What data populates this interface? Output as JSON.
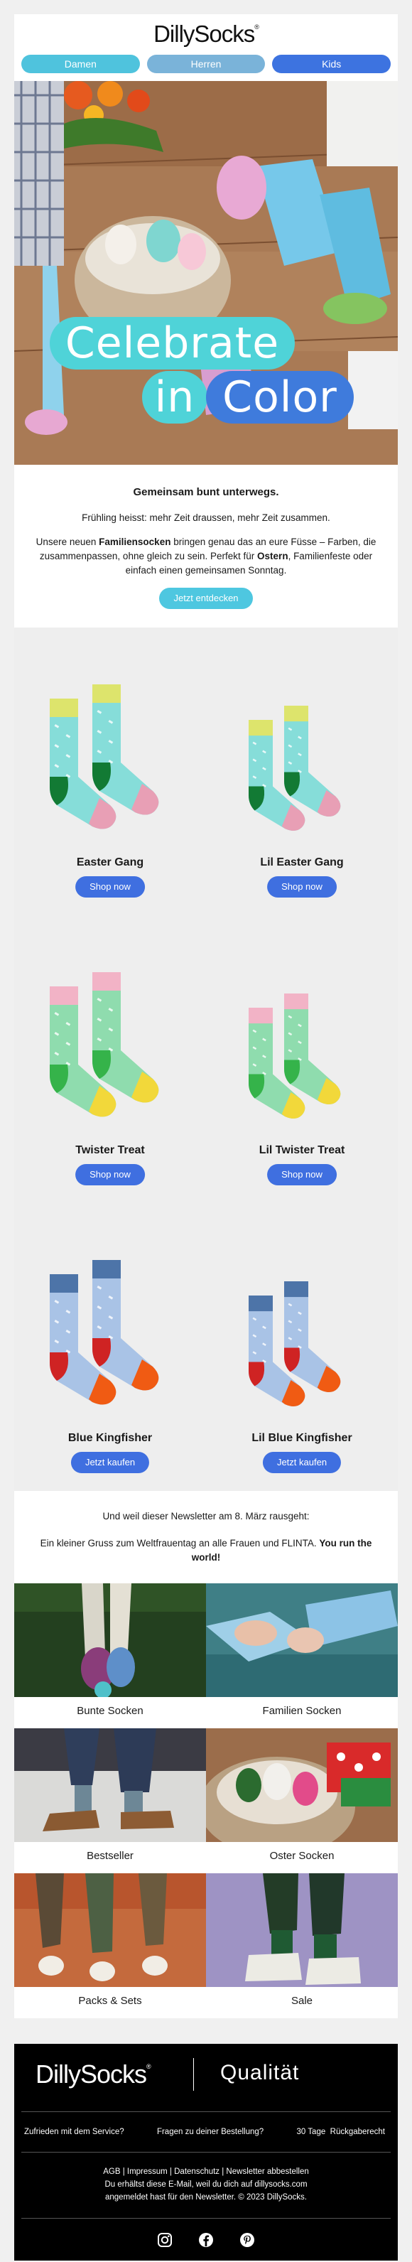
{
  "brand": {
    "name": "DillySocks",
    "mark": "®"
  },
  "nav": [
    {
      "label": "Damen",
      "color": "#4fc3dd"
    },
    {
      "label": "Herren",
      "color": "#7ab3d9"
    },
    {
      "label": "Kids",
      "color": "#3d73e0"
    }
  ],
  "hero": {
    "line1": "Celebrate",
    "line2a": "in",
    "line2b": "Color",
    "colors": {
      "cyan": "#4fd3d8",
      "blue": "#3f7bdc"
    }
  },
  "intro": {
    "heading": "Gemeinsam bunt unterwegs.",
    "line1": "Frühling heisst: mehr Zeit draussen, mehr Zeit zusammen.",
    "para_a": "Unsere neuen ",
    "para_b": "Familiensocken",
    "para_c": " bringen genau das an eure Füsse – Farben, die zusammenpassen, ohne gleich zu sein. Perfekt für ",
    "para_d": "Ostern",
    "para_e": ", Familienfeste oder einfach einen gemeinsamen Sonntag.",
    "button": "Jetzt entdecken"
  },
  "products": [
    {
      "name": "Easter Gang",
      "button": "Shop now",
      "colors": {
        "body": "#86ddd9",
        "cuff": "#dde46c",
        "heel": "#127a34",
        "toe": "#e89fb5"
      }
    },
    {
      "name": "Lil Easter Gang",
      "button": "Shop now",
      "colors": {
        "body": "#86ddd9",
        "cuff": "#dde46c",
        "heel": "#127a34",
        "toe": "#e89fb5"
      }
    },
    {
      "name": "Twister Treat",
      "button": "Shop now",
      "colors": {
        "body": "#8fdcae",
        "cuff": "#f2b3c6",
        "heel": "#35b34a",
        "toe": "#f2d83a"
      }
    },
    {
      "name": "Lil Twister Treat",
      "button": "Shop now",
      "colors": {
        "body": "#8fdcae",
        "cuff": "#f2b3c6",
        "heel": "#35b34a",
        "toe": "#f2d83a"
      }
    },
    {
      "name": "Blue Kingfisher",
      "button": "Jetzt kaufen",
      "colors": {
        "body": "#a9c3e6",
        "cuff": "#4d74a8",
        "heel": "#cf2323",
        "toe": "#f05b13"
      }
    },
    {
      "name": "Lil Blue Kingfisher",
      "button": "Jetzt kaufen",
      "colors": {
        "body": "#a9c3e6",
        "cuff": "#4d74a8",
        "heel": "#cf2323",
        "toe": "#f05b13"
      }
    }
  ],
  "message": {
    "line1": "Und weil dieser Newsletter am 8. März rausgeht:",
    "line2a": "Ein kleiner Gruss zum Weltfrauentag an alle Frauen und FLINTA. ",
    "line2b": "You run the world!"
  },
  "categories": [
    {
      "label": "Bunte Socken"
    },
    {
      "label": "Familien Socken"
    },
    {
      "label": "Bestseller"
    },
    {
      "label": "Oster Socken"
    },
    {
      "label": "Packs & Sets"
    },
    {
      "label": "Sale"
    }
  ],
  "footer": {
    "tagline": "Qualität",
    "links": [
      "Zufrieden mit dem Service?",
      "Fragen zu deiner Bestellung?",
      "30 Tage  Rückgaberecht"
    ],
    "legal_links": "AGB | Impressum | Datenschutz | Newsletter abbestellen",
    "legal_line2": "Du erhältst diese E-Mail, weil du dich auf dillysocks.com",
    "legal_line3": "angemeldet hast für den Newsletter. © 2023 DillySocks.",
    "social": [
      "instagram-icon",
      "facebook-icon",
      "pinterest-icon"
    ]
  },
  "colors": {
    "button": "#3f6fe0",
    "cta": "#4ec7e0"
  }
}
